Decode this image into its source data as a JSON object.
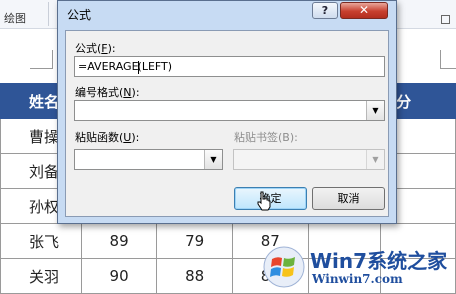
{
  "background": {
    "ribbon_group_label": "绘图",
    "table": {
      "header": [
        "姓名",
        "",
        "",
        "",
        "",
        "总分"
      ],
      "rows": [
        [
          "曹操",
          "",
          "",
          "",
          "",
          ""
        ],
        [
          "刘备",
          "",
          "",
          "",
          "",
          ""
        ],
        [
          "孙权",
          "",
          "",
          "",
          "",
          ""
        ],
        [
          "张飞",
          "89",
          "79",
          "87",
          "",
          ""
        ],
        [
          "关羽",
          "90",
          "88",
          "80",
          "",
          ""
        ]
      ]
    }
  },
  "dialog": {
    "title": "公式",
    "help_label": "?",
    "close_label": "✕",
    "formula": {
      "label": "公式(",
      "key": "F",
      "label_end": "):",
      "value_before_caret": "=AVERAGE",
      "value_after_caret": "(LEFT)"
    },
    "number_format": {
      "label": "编号格式(",
      "key": "N",
      "label_end": "):",
      "value": ""
    },
    "paste_function": {
      "label": "粘贴函数(",
      "key": "U",
      "label_end": "):",
      "value": ""
    },
    "paste_bookmark": {
      "label": "粘贴书签(B):",
      "value": ""
    },
    "ok_label": "确定",
    "cancel_label": "取消",
    "dropdown_arrow": "▼"
  },
  "watermark": {
    "brand": "Win7系统之家",
    "url": "Winwin7.com",
    "icon": "windows-flag-icon"
  },
  "colors": {
    "table_header": "#2f5597",
    "dialog_frame": "#c7dbf3",
    "close_red": "#c8402f",
    "watermark": "#1f4e9e"
  }
}
